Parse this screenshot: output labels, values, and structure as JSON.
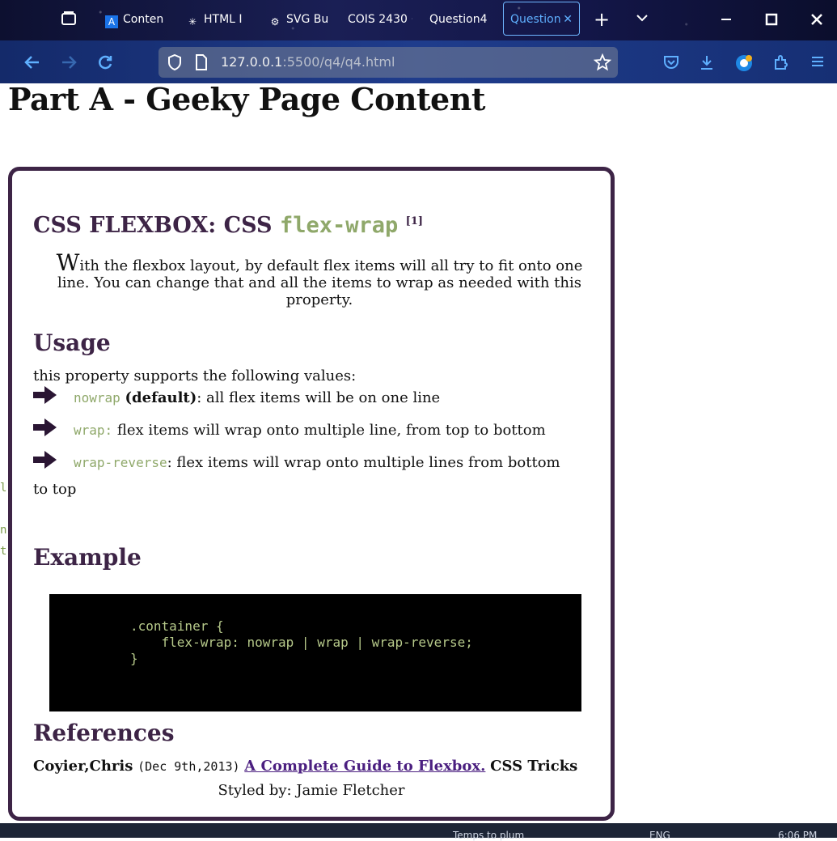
{
  "browser": {
    "tabs": [
      {
        "label": "Conten",
        "icon": "A"
      },
      {
        "label": "HTML I",
        "icon": "✳"
      },
      {
        "label": "SVG Bu",
        "icon": "⚙"
      },
      {
        "label": "COIS 2430 ·",
        "icon": ""
      },
      {
        "label": "Question4",
        "icon": ""
      },
      {
        "label": "Question",
        "icon": ""
      }
    ],
    "url_host": "127.0.0.1",
    "url_path": ":5500/q4/q4.html"
  },
  "page": {
    "title": "Part A - Geeky Page Content",
    "heading_prefix": "CSS FLEXBOX: CSS ",
    "heading_code": "flex-wrap",
    "heading_ref": "[1]",
    "intro_first": "W",
    "intro_rest": "ith the flexbox layout, by default flex items will all try to fit onto one line. You can change that and all the items to wrap as needed with this property.",
    "usage_heading": "Usage",
    "usage_text": "this property supports the following values:",
    "items": [
      {
        "code": "nowrap",
        "bold": "(default)",
        "text": ": all flex items will be on one line"
      },
      {
        "code": "wrap:",
        "bold": "",
        "text": " flex items will wrap onto multiple line, from top to bottom"
      },
      {
        "code": "wrap-reverse",
        "bold": "",
        "text": ": flex items will wrap onto multiple lines from bottom"
      }
    ],
    "item3_continuation": "to top",
    "example_heading": "Example",
    "code": ".container {\n    flex-wrap: nowrap | wrap | wrap-reverse;\n}",
    "references_heading": "References",
    "ref_author": "Coyier,Chris",
    "ref_date": "(Dec 9th,2013)",
    "ref_link": "A Complete Guide to Flexbox.",
    "ref_site": "CSS Tricks",
    "styled_by": "Styled by: Jamie Fletcher"
  },
  "taskbar": {
    "weather": "Temps to plum",
    "lang": "ENG",
    "time": "6:06 PM"
  },
  "colors": {
    "accent": "#3d2446",
    "code": "#8fa86a",
    "link": "#4b1f80"
  }
}
